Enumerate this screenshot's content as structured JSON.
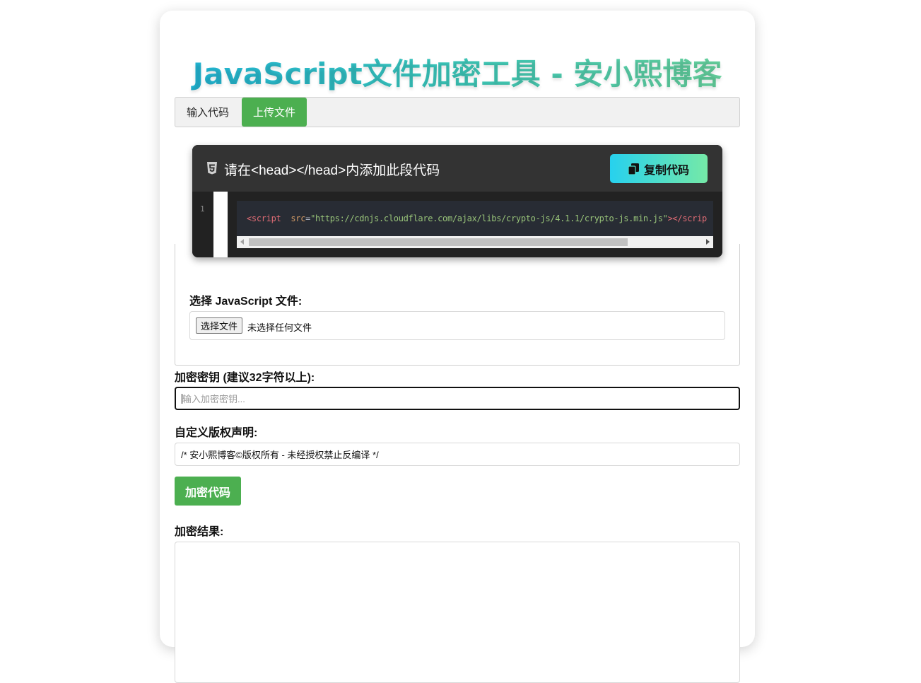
{
  "page": {
    "title": "JavaScript文件加密工具 - 安小熙博客"
  },
  "tabs": [
    {
      "label": "输入代码",
      "active": false
    },
    {
      "label": "上传文件",
      "active": true
    }
  ],
  "snippet": {
    "header_text": "请在<head></head>内添加此段代码",
    "icon": "html5-icon",
    "copy_label": "复制代码",
    "line_number": "1",
    "code": {
      "open": "<script",
      "attr": "src",
      "eq": "=",
      "value": "\"https://cdnjs.cloudflare.com/ajax/libs/crypto-js/4.1.1/crypto-js.min.js\"",
      "close": "></scrip"
    }
  },
  "upload": {
    "label": "选择 JavaScript 文件:",
    "choose_button": "选择文件",
    "no_file": "未选择任何文件"
  },
  "key": {
    "label": "加密密钥 (建议32字符以上):",
    "placeholder": "输入加密密钥..."
  },
  "copyright": {
    "label": "自定义版权声明:",
    "value": "/* 安小熙博客©版权所有 - 未经授权禁止反编译 */"
  },
  "encrypt_button": "加密代码",
  "result": {
    "label": "加密结果:",
    "value": ""
  },
  "colors": {
    "accent_green": "#4caf50",
    "title_gradient_start": "#1fb4d8",
    "title_gradient_end": "#6bd39a",
    "copy_gradient_start": "#27d1ee",
    "copy_gradient_end": "#75e9a7",
    "code_bg": "#282c34"
  }
}
